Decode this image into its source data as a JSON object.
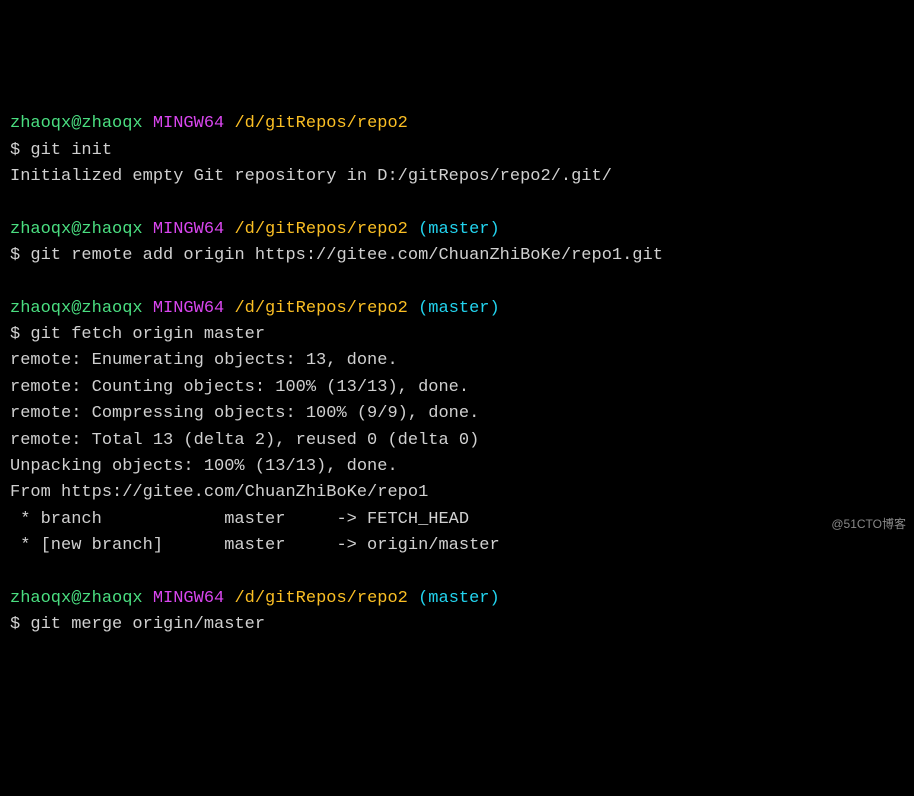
{
  "blocks": [
    {
      "prompt": {
        "user": "zhaoqx@zhaoqx",
        "system": "MINGW64",
        "path": "/d/gitRepos/repo2",
        "branch": null
      },
      "command": "git init",
      "output": [
        "Initialized empty Git repository in D:/gitRepos/repo2/.git/"
      ]
    },
    {
      "prompt": {
        "user": "zhaoqx@zhaoqx",
        "system": "MINGW64",
        "path": "/d/gitRepos/repo2",
        "branch": "(master)"
      },
      "command": "git remote add origin https://gitee.com/ChuanZhiBoKe/repo1.git",
      "output": []
    },
    {
      "prompt": {
        "user": "zhaoqx@zhaoqx",
        "system": "MINGW64",
        "path": "/d/gitRepos/repo2",
        "branch": "(master)"
      },
      "command": "git fetch origin master",
      "output": [
        "remote: Enumerating objects: 13, done.",
        "remote: Counting objects: 100% (13/13), done.",
        "remote: Compressing objects: 100% (9/9), done.",
        "remote: Total 13 (delta 2), reused 0 (delta 0)",
        "Unpacking objects: 100% (13/13), done.",
        "From https://gitee.com/ChuanZhiBoKe/repo1",
        " * branch            master     -> FETCH_HEAD",
        " * [new branch]      master     -> origin/master"
      ]
    },
    {
      "prompt": {
        "user": "zhaoqx@zhaoqx",
        "system": "MINGW64",
        "path": "/d/gitRepos/repo2",
        "branch": "(master)"
      },
      "command": "git merge origin/master",
      "output": []
    }
  ],
  "dollar": "$ ",
  "watermark": "@51CTO博客"
}
